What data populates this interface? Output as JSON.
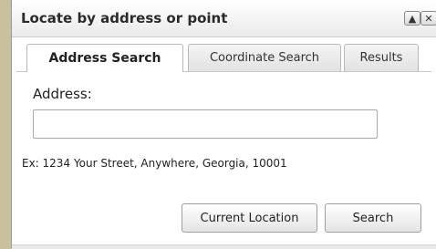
{
  "window": {
    "title": "Locate by address or point",
    "collapse_icon": "▲",
    "close_icon": "✕"
  },
  "tabs": [
    {
      "label": "Address Search",
      "active": true
    },
    {
      "label": "Coordinate Search",
      "active": false
    },
    {
      "label": "Results",
      "active": false
    }
  ],
  "address_form": {
    "label": "Address:",
    "input_value": "",
    "example": "Ex: 1234 Your Street, Anywhere, Georgia, 10001"
  },
  "buttons": {
    "current_location": "Current Location",
    "search": "Search"
  }
}
